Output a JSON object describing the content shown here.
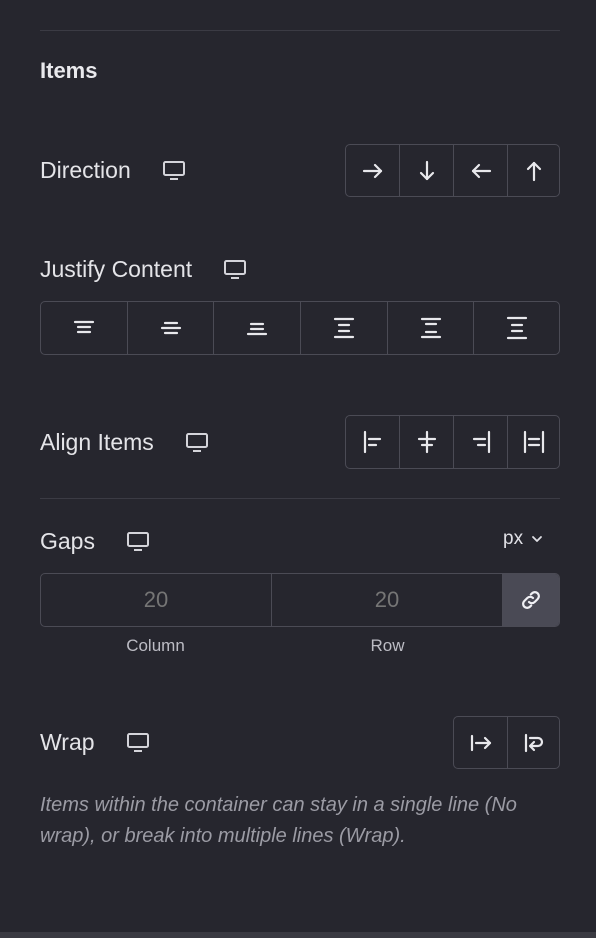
{
  "section": {
    "title": "Items"
  },
  "direction": {
    "label": "Direction",
    "device_icon": "desktop-monitor-icon",
    "options": [
      {
        "name": "row",
        "icon": "arrow-right-icon"
      },
      {
        "name": "column",
        "icon": "arrow-down-icon"
      },
      {
        "name": "row-reverse",
        "icon": "arrow-left-icon"
      },
      {
        "name": "column-reverse",
        "icon": "arrow-up-icon"
      }
    ]
  },
  "justify_content": {
    "label": "Justify Content",
    "device_icon": "desktop-monitor-icon",
    "options": [
      {
        "name": "start",
        "icon": "justify-start-icon"
      },
      {
        "name": "center",
        "icon": "justify-center-icon"
      },
      {
        "name": "end",
        "icon": "justify-end-icon"
      },
      {
        "name": "space-between",
        "icon": "justify-space-between-icon"
      },
      {
        "name": "space-around",
        "icon": "justify-space-around-icon"
      },
      {
        "name": "space-evenly",
        "icon": "justify-space-evenly-icon"
      }
    ]
  },
  "align_items": {
    "label": "Align Items",
    "device_icon": "desktop-monitor-icon",
    "options": [
      {
        "name": "start",
        "icon": "align-start-icon"
      },
      {
        "name": "center",
        "icon": "align-center-icon"
      },
      {
        "name": "end",
        "icon": "align-end-icon"
      },
      {
        "name": "stretch",
        "icon": "align-stretch-icon"
      }
    ]
  },
  "gaps": {
    "label": "Gaps",
    "device_icon": "desktop-monitor-icon",
    "unit": "px",
    "column": {
      "placeholder": "20",
      "label": "Column"
    },
    "row": {
      "placeholder": "20",
      "label": "Row"
    },
    "link_icon": "link-icon"
  },
  "wrap": {
    "label": "Wrap",
    "device_icon": "desktop-monitor-icon",
    "options": [
      {
        "name": "nowrap",
        "icon": "no-wrap-icon"
      },
      {
        "name": "wrap",
        "icon": "wrap-icon"
      }
    ],
    "help": "Items within the container can stay in a single line (No wrap), or break into multiple lines (Wrap)."
  },
  "colors": {
    "background": "#26262e",
    "border": "#4b4b55",
    "active_button": "#4a4a55",
    "text": "#e4e4e8",
    "muted": "#9b9ba4"
  }
}
